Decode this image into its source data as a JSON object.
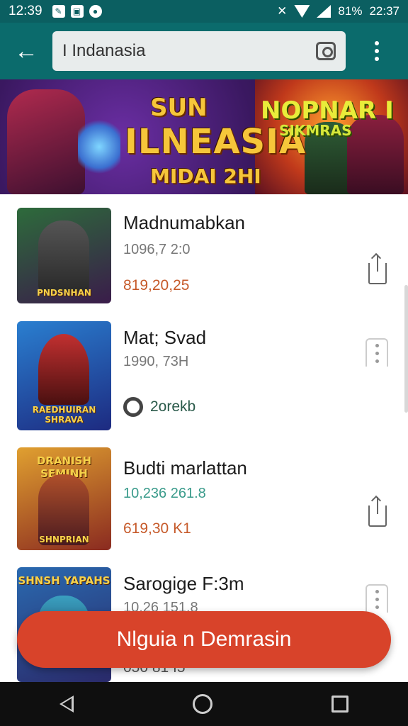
{
  "status_bar": {
    "time": "12:39",
    "battery_text": "81%",
    "clock_right": "22:37"
  },
  "app_bar": {
    "search_value": "I Indanasia"
  },
  "banner": {
    "line1": "SUN",
    "line2": "ILNEASIA",
    "line3": "MIDAI 2HI",
    "right_line1": "NOPNAR I",
    "right_line2": "SIKMRAS"
  },
  "list": [
    {
      "title": "Madnumabkan",
      "meta": "1096,7 2:0",
      "price": "819,20,25",
      "thumb_caption": "PNDSNHAN",
      "thumb_colors": [
        "#2d6b3b",
        "#3a1c4a"
      ],
      "action": "share-icon"
    },
    {
      "title": "Mat; Svad",
      "meta": "1990, 73H",
      "badge": "2orekb",
      "thumb_caption": "RAEDHUIRAN SHRAVA",
      "thumb_colors": [
        "#2a7fd0",
        "#1d2a80"
      ],
      "action": "kebab-menu-icon"
    },
    {
      "title": "Budti marlattan",
      "meta": "10,236 261.8",
      "price": "619,30 K1",
      "thumb_caption_top": "DRANISH SEMINH",
      "thumb_caption": "SHNPRIAN",
      "thumb_colors": [
        "#e0a030",
        "#8a2a20"
      ],
      "action": "share-icon"
    },
    {
      "title": "Sarogige F:3m",
      "meta": "10,26 151.8",
      "price": "050 81 f5",
      "thumb_caption_top": "SHNSH YAPAHS",
      "thumb_colors": [
        "#2a6ab0",
        "#2a2a6a"
      ],
      "action": "kebab-menu-icon"
    }
  ],
  "fab": {
    "label": "Nlguia n Demrasin"
  },
  "colors": {
    "app_bar": "#0b6b6c",
    "fab": "#d8432a",
    "price": "#c65a2a"
  }
}
